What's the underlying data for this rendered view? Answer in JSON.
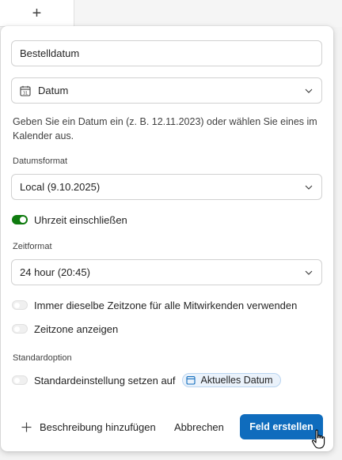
{
  "toolbar": {
    "add_column_glyph": "+"
  },
  "form": {
    "name_value": "Bestelldatum",
    "type": {
      "label": "Datum",
      "icon": "calendar-icon"
    },
    "help_text": "Geben Sie ein Datum ein (z. B. 12.11.2023) oder wählen Sie eines im Kalender aus.",
    "date_format": {
      "label": "Datumsformat",
      "value": "Local (9.10.2025)"
    },
    "include_time": {
      "label": "Uhrzeit einschließen",
      "on": true
    },
    "time_format": {
      "label": "Zeitformat",
      "value": "24 hour (20:45)"
    },
    "same_timezone": {
      "label": "Immer dieselbe Zeitzone für alle Mitwirkenden verwenden",
      "on": false
    },
    "show_timezone": {
      "label": "Zeitzone anzeigen",
      "on": false
    },
    "default_option": {
      "section_label": "Standardoption",
      "label": "Standardeinstellung setzen auf",
      "on": false,
      "chip_label": "Aktuelles Datum"
    }
  },
  "footer": {
    "add_description": "Beschreibung hinzufügen",
    "cancel": "Abbrechen",
    "create": "Feld erstellen"
  },
  "colors": {
    "accent": "#0f6cbd",
    "toggle_on": "#0f7b0f"
  }
}
